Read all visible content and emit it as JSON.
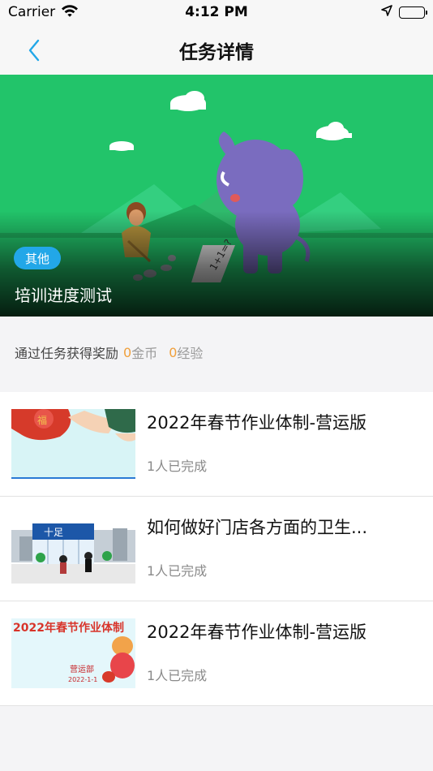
{
  "status_bar": {
    "carrier": "Carrier",
    "time": "4:12 PM",
    "icons": [
      "wifi-icon",
      "location-arrow-icon",
      "battery-icon"
    ]
  },
  "nav": {
    "back_icon": "chevron-left-icon",
    "title": "任务详情",
    "accent_color": "#22a7e8"
  },
  "banner": {
    "category": "其他",
    "title": "培训进度测试",
    "background_color": "#22c46a"
  },
  "reward": {
    "prefix": "通过任务获得奖励",
    "coins_value": "0",
    "coins_unit": "金币",
    "exp_value": "0",
    "exp_unit": "经验",
    "value_color": "#f0a03c"
  },
  "tasks": [
    {
      "title": "2022年春节作业体制-营运版",
      "completed": "1人已完成"
    },
    {
      "title": "如何做好门店各方面的卫生...",
      "completed": "1人已完成",
      "thumb_sign": "十足"
    },
    {
      "title": "2022年春节作业体制-营运版",
      "completed": "1人已完成",
      "thumb_heading": "2022年春节作业体制",
      "thumb_dept": "营运部",
      "thumb_date": "2022-1-1"
    }
  ]
}
